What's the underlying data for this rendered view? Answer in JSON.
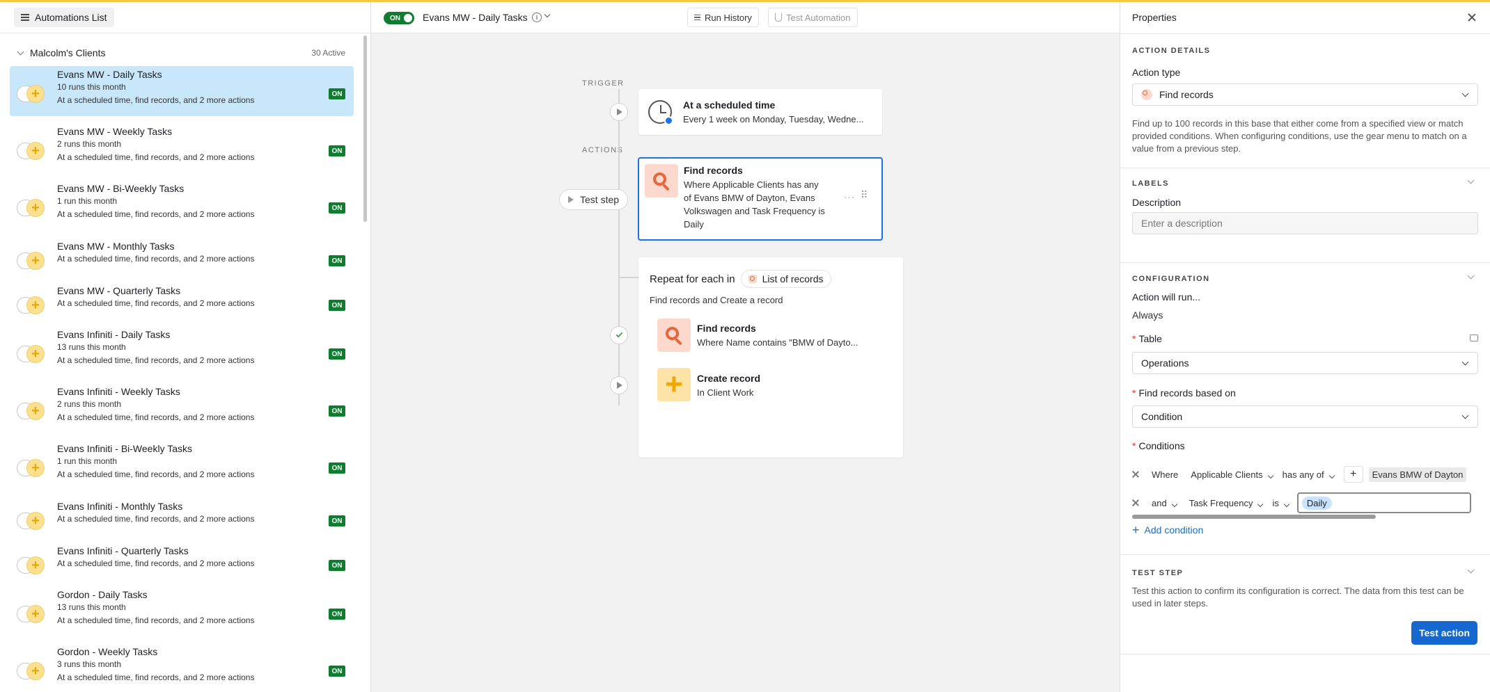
{
  "left_panel": {
    "list_button_label": "Automations List",
    "group": {
      "title": "Malcolm's Clients",
      "count": "30 Active"
    },
    "items": [
      {
        "title": "Evans MW - Daily Tasks",
        "runs": "10 runs this month",
        "desc": "At a scheduled time, find records, and 2 more actions",
        "status": "ON",
        "selected": true
      },
      {
        "title": "Evans MW - Weekly Tasks",
        "runs": "2 runs this month",
        "desc": "At a scheduled time, find records, and 2 more actions",
        "status": "ON"
      },
      {
        "title": "Evans MW - Bi-Weekly Tasks",
        "runs": "1 run this month",
        "desc": "At a scheduled time, find records, and 2 more actions",
        "status": "ON"
      },
      {
        "title": "Evans MW - Monthly Tasks",
        "runs": "",
        "desc": "At a scheduled time, find records, and 2 more actions",
        "status": "ON"
      },
      {
        "title": "Evans MW - Quarterly Tasks",
        "runs": "",
        "desc": "At a scheduled time, find records, and 2 more actions",
        "status": "ON"
      },
      {
        "title": "Evans Infiniti - Daily Tasks",
        "runs": "13 runs this month",
        "desc": "At a scheduled time, find records, and 2 more actions",
        "status": "ON"
      },
      {
        "title": "Evans Infiniti - Weekly Tasks",
        "runs": "2 runs this month",
        "desc": "At a scheduled time, find records, and 2 more actions",
        "status": "ON"
      },
      {
        "title": "Evans Infiniti - Bi-Weekly Tasks",
        "runs": "1 run this month",
        "desc": "At a scheduled time, find records, and 2 more actions",
        "status": "ON"
      },
      {
        "title": "Evans Infiniti - Monthly Tasks",
        "runs": "",
        "desc": "At a scheduled time, find records, and 2 more actions",
        "status": "ON"
      },
      {
        "title": "Evans Infiniti - Quarterly Tasks",
        "runs": "",
        "desc": "At a scheduled time, find records, and 2 more actions",
        "status": "ON"
      },
      {
        "title": "Gordon - Daily Tasks",
        "runs": "13 runs this month",
        "desc": "At a scheduled time, find records, and 2 more actions",
        "status": "ON"
      },
      {
        "title": "Gordon - Weekly Tasks",
        "runs": "3 runs this month",
        "desc": "At a scheduled time, find records, and 2 more actions",
        "status": "ON"
      }
    ]
  },
  "header": {
    "toggle_label": "ON",
    "title": "Evans MW - Daily Tasks",
    "info_glyph": "i",
    "run_history_label": "Run History",
    "test_automation_label": "Test Automation"
  },
  "canvas": {
    "trigger_label": "TRIGGER",
    "actions_label": "ACTIONS",
    "trigger_card": {
      "title": "At a scheduled time",
      "subtitle": "Every 1 week on Monday, Tuesday, Wedne..."
    },
    "test_step_label": "Test step",
    "find_card": {
      "title": "Find records",
      "lines": [
        "Where Applicable Clients has any",
        "of Evans BMW of Dayton, Evans",
        "Volkswagen and Task Frequency is",
        "Daily"
      ]
    },
    "repeat_card": {
      "title": "Repeat for each in",
      "chip_label": "List of records",
      "subtitle": "Find records and Create a record",
      "sub_find_title": "Find records",
      "sub_find_desc": "Where Name contains \"BMW of Dayto...",
      "sub_create_title": "Create record",
      "sub_create_desc": "In Client Work"
    }
  },
  "properties": {
    "title": "Properties",
    "action_details_header": "ACTION DETAILS",
    "action_type_label": "Action type",
    "action_type_value": "Find records",
    "help_text": "Find up to 100 records in this base that either come from a specified view or match provided conditions. When configuring conditions, use the gear menu to match on a value from a previous step.",
    "labels_header": "LABELS",
    "description_label": "Description",
    "description_placeholder": "Enter a description",
    "configuration_header": "CONFIGURATION",
    "action_will_run_label": "Action will run...",
    "action_will_run_value": "Always",
    "table_label": "Table",
    "table_value": "Operations",
    "based_on_label": "Find records based on",
    "based_on_value": "Condition",
    "conditions_label": "Conditions",
    "condition_rows": [
      {
        "prefix": "Where",
        "field": "Applicable Clients",
        "op": "has any of",
        "value": "Evans BMW of Dayton"
      },
      {
        "prefix": "and",
        "field": "Task Frequency",
        "op": "is",
        "value": "Daily"
      }
    ],
    "add_condition_label": "Add condition",
    "test_step_header": "TEST STEP",
    "test_step_help": "Test this action to confirm its configuration is correct. The data from this test can be used in later steps.",
    "test_action_label": "Test action"
  },
  "colors": {
    "accent_blue": "#1468d0",
    "on_green": "#0f7c2f",
    "selected_bg": "#c9e7fb",
    "find_icon_bg": "#fcd9cc",
    "create_icon_bg": "#fde3a6"
  }
}
